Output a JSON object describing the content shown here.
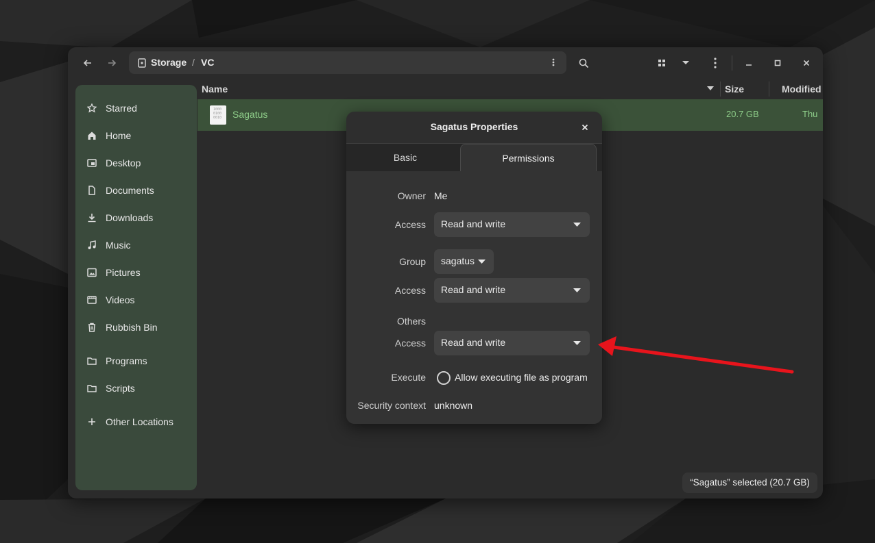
{
  "window": {
    "breadcrumb": {
      "root": "Storage",
      "separator": "/",
      "current": "VC"
    }
  },
  "sidebar": {
    "items": [
      {
        "label": "Starred",
        "icon": "star-icon"
      },
      {
        "label": "Home",
        "icon": "home-icon"
      },
      {
        "label": "Desktop",
        "icon": "desktop-icon"
      },
      {
        "label": "Documents",
        "icon": "document-icon"
      },
      {
        "label": "Downloads",
        "icon": "download-icon"
      },
      {
        "label": "Music",
        "icon": "music-icon"
      },
      {
        "label": "Pictures",
        "icon": "picture-icon"
      },
      {
        "label": "Videos",
        "icon": "video-icon"
      },
      {
        "label": "Rubbish Bin",
        "icon": "trash-icon"
      },
      {
        "label": "Programs",
        "icon": "folder-icon"
      },
      {
        "label": "Scripts",
        "icon": "folder-icon"
      },
      {
        "label": "Other Locations",
        "icon": "plus-icon"
      }
    ]
  },
  "file_list": {
    "columns": {
      "name": "Name",
      "size": "Size",
      "modified": "Modified"
    },
    "rows": [
      {
        "name": "Sagatus",
        "size": "20.7 GB",
        "modified": "Thu",
        "icon_text": "1000\n0100\n0010"
      }
    ]
  },
  "status": {
    "text": "“Sagatus” selected  (20.7 GB)"
  },
  "dialog": {
    "title": "Sagatus Properties",
    "tabs": {
      "basic": "Basic",
      "permissions": "Permissions"
    },
    "owner": {
      "label": "Owner",
      "value": "Me",
      "access_label": "Access",
      "access_value": "Read and write"
    },
    "group": {
      "label": "Group",
      "value": "sagatus",
      "access_label": "Access",
      "access_value": "Read and write"
    },
    "others": {
      "label": "Others",
      "access_label": "Access",
      "access_value": "Read and write"
    },
    "execute": {
      "label": "Execute",
      "option": "Allow executing file as program",
      "checked": false
    },
    "security": {
      "label": "Security context",
      "value": "unknown"
    }
  },
  "colors": {
    "sidebar_bg": "#3a4a3c",
    "selection_bg": "#3b5239",
    "selection_text": "#8fcf8a",
    "annotation_arrow": "#e8141c"
  }
}
